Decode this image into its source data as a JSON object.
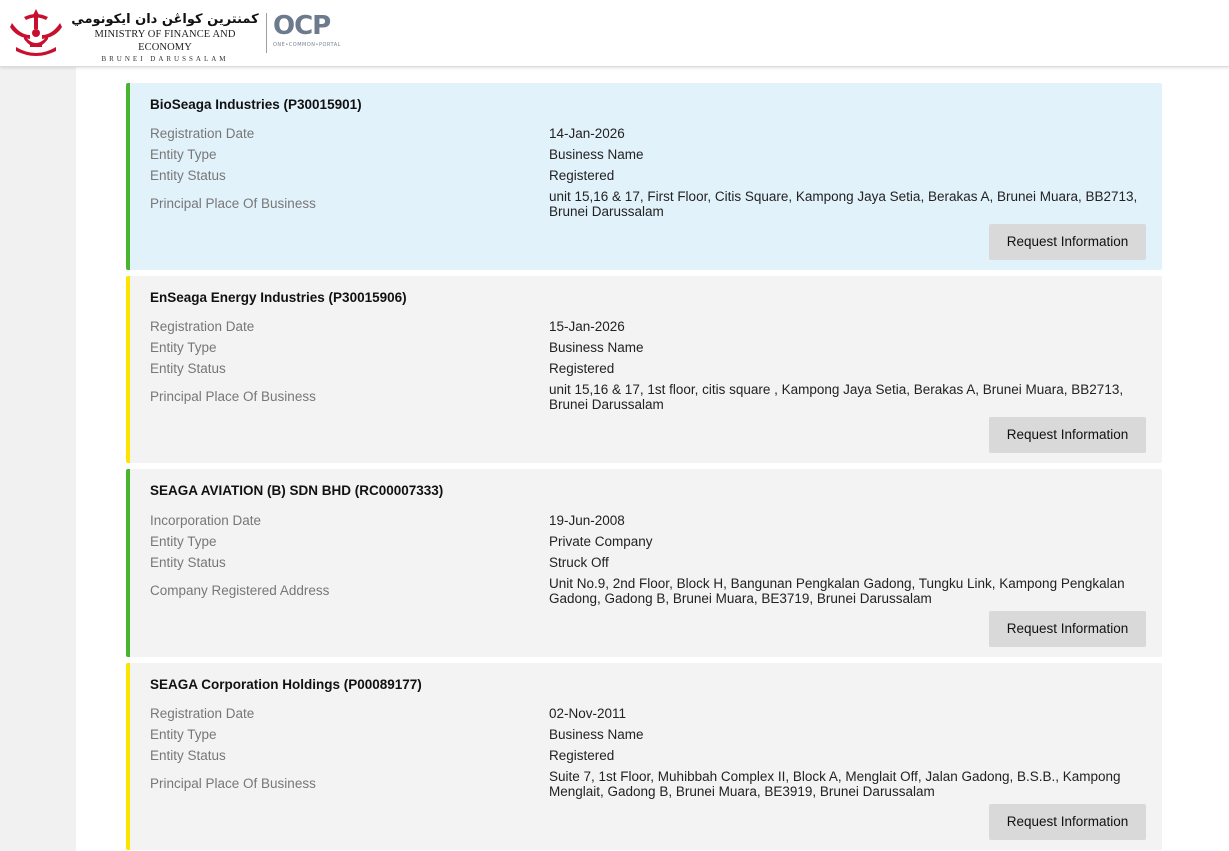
{
  "header": {
    "ministry_jawi": "كمنترين كواڠن دان ايكونومي",
    "ministry_name": "MINISTRY OF FINANCE AND ECONOMY",
    "ministry_country": "BRUNEI DARUSSALAM",
    "portal_logo": "OCP",
    "portal_tagline": "ONE•COMMON•PORTAL"
  },
  "results": [
    {
      "title": "BioSeaga Industries (P30015901)",
      "accent": "#49b52f",
      "fields": [
        {
          "label": "Registration Date",
          "value": "14-Jan-2026"
        },
        {
          "label": "Entity Type",
          "value": "Business Name"
        },
        {
          "label": "Entity Status",
          "value": "Registered"
        },
        {
          "label": "Principal Place Of Business",
          "value": "unit 15,16 & 17, First Floor, Citis Square, Kampong Jaya Setia, Berakas A, Brunei Muara, BB2713, Brunei Darussalam"
        }
      ],
      "button": "Request Information"
    },
    {
      "title": "EnSeaga Energy Industries (P30015906)",
      "accent": "#fde400",
      "fields": [
        {
          "label": "Registration Date",
          "value": "15-Jan-2026"
        },
        {
          "label": "Entity Type",
          "value": "Business Name"
        },
        {
          "label": "Entity Status",
          "value": "Registered"
        },
        {
          "label": "Principal Place Of Business",
          "value": "unit 15,16 & 17, 1st floor, citis square , Kampong Jaya Setia, Berakas A, Brunei Muara, BB2713, Brunei Darussalam"
        }
      ],
      "button": "Request Information"
    },
    {
      "title": "SEAGA AVIATION (B) SDN BHD (RC00007333)",
      "accent": "#49b52f",
      "fields": [
        {
          "label": "Incorporation Date",
          "value": "19-Jun-2008"
        },
        {
          "label": "Entity Type",
          "value": "Private Company"
        },
        {
          "label": "Entity Status",
          "value": "Struck Off"
        },
        {
          "label": "Company Registered Address",
          "value": "Unit No.9, 2nd Floor, Block H, Bangunan Pengkalan Gadong, Tungku Link, Kampong Pengkalan Gadong, Gadong B, Brunei Muara, BE3719, Brunei Darussalam"
        }
      ],
      "button": "Request Information"
    },
    {
      "title": "SEAGA Corporation Holdings (P00089177)",
      "accent": "#fde400",
      "fields": [
        {
          "label": "Registration Date",
          "value": "02-Nov-2011"
        },
        {
          "label": "Entity Type",
          "value": "Business Name"
        },
        {
          "label": "Entity Status",
          "value": "Registered"
        },
        {
          "label": "Principal Place Of Business",
          "value": "Suite 7, 1st Floor, Muhibbah Complex II, Block A, Menglait Off, Jalan Gadong, B.S.B., Kampong Menglait, Gadong B, Brunei Muara, BE3919, Brunei Darussalam"
        }
      ],
      "button": "Request Information"
    }
  ]
}
